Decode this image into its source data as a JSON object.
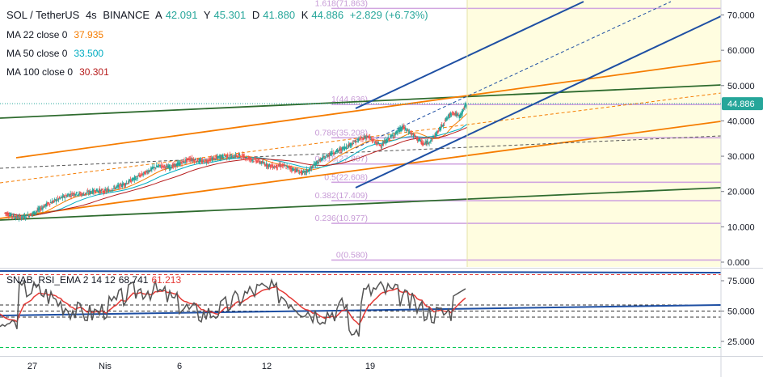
{
  "header": {
    "symbol": "SOL / TetherUS",
    "interval": "4s",
    "exchange": "BINANCE",
    "ohlc": {
      "open_label": "A",
      "open": "42.091",
      "high_label": "Y",
      "high": "45.301",
      "low_label": "D",
      "low": "41.880",
      "close_label": "K",
      "close": "44.886",
      "change": "+2.829 (+6.73%)"
    }
  },
  "indicators": [
    {
      "label": "MA 22 close 0",
      "value": "37.935",
      "color": "#f57c00"
    },
    {
      "label": "MA 50 close 0",
      "value": "33.500",
      "color": "#00acc1"
    },
    {
      "label": "MA 100 close 0",
      "value": "30.301",
      "color": "#b71c1c"
    }
  ],
  "rsi_legend": {
    "label": "SNAB_RSI_EMA 2 14 12",
    "value1": "68.741",
    "value1_color": "#131722",
    "value2": "61.213",
    "value2_color": "#e53935"
  },
  "price_badge": {
    "value": "44.886",
    "color": "#26a69a"
  },
  "colors": {
    "up": "#26a69a",
    "down": "#ef5350",
    "fib_line": "#d1a6e0",
    "fib_text": "#c79bd6",
    "orange": "#f57c00",
    "green": "#2e6b2e",
    "blue": "#1e4fa3",
    "rsi": "#555555",
    "rsi_ema": "#e53935",
    "projection": "#fffde0"
  },
  "chart_data": {
    "type": "candlestick",
    "price_axis": {
      "ylim": [
        0,
        73
      ],
      "ticks": [
        "70.000",
        "60.000",
        "50.000",
        "40.000",
        "30.000",
        "20.000",
        "10.000",
        "0.000"
      ]
    },
    "time_axis": {
      "ticks": [
        "27",
        "Nis",
        "6",
        "12",
        "19"
      ]
    },
    "fibonacci": [
      {
        "label": "1.618(71.863)",
        "level": 71.863
      },
      {
        "label": "1(44.636)",
        "level": 44.636
      },
      {
        "label": "0.786(35.208)",
        "level": 35.208
      },
      {
        "label": "0.618(27.807)",
        "level": 27.807
      },
      {
        "label": "0.5(22.608)",
        "level": 22.608
      },
      {
        "label": "0.382(17.409)",
        "level": 17.409
      },
      {
        "label": "0.236(10.977)",
        "level": 10.977
      },
      {
        "label": "0(0.580)",
        "level": 0.58
      }
    ],
    "price_path": [
      [
        0,
        14.0
      ],
      [
        1,
        13.2
      ],
      [
        2,
        12.6
      ],
      [
        3,
        12.9
      ],
      [
        4,
        13.8
      ],
      [
        5,
        15.0
      ],
      [
        6,
        16.4
      ],
      [
        7,
        17.3
      ],
      [
        8,
        18.2
      ],
      [
        9,
        19.0
      ],
      [
        10,
        19.5
      ],
      [
        11,
        19.2
      ],
      [
        12,
        19.8
      ],
      [
        13,
        20.3
      ],
      [
        14,
        20.0
      ],
      [
        15,
        20.6
      ],
      [
        16,
        21.4
      ],
      [
        17,
        22.2
      ],
      [
        18,
        23.3
      ],
      [
        19,
        24.4
      ],
      [
        20,
        25.5
      ],
      [
        21,
        26.7
      ],
      [
        22,
        27.3
      ],
      [
        23,
        26.8
      ],
      [
        24,
        27.4
      ],
      [
        25,
        28.2
      ],
      [
        26,
        29.2
      ],
      [
        27,
        28.8
      ],
      [
        28,
        28.4
      ],
      [
        29,
        29.1
      ],
      [
        30,
        29.6
      ],
      [
        31,
        30.1
      ],
      [
        32,
        29.8
      ],
      [
        33,
        30.3
      ],
      [
        34,
        29.6
      ],
      [
        35,
        29.0
      ],
      [
        36,
        28.3
      ],
      [
        37,
        27.5
      ],
      [
        38,
        27.0
      ],
      [
        39,
        27.4
      ],
      [
        40,
        26.8
      ],
      [
        41,
        26.0
      ],
      [
        42,
        25.2
      ],
      [
        43,
        26.3
      ],
      [
        44,
        28.3
      ],
      [
        45,
        29.6
      ],
      [
        46,
        30.9
      ],
      [
        47,
        31.6
      ],
      [
        48,
        32.6
      ],
      [
        49,
        33.8
      ],
      [
        50,
        34.8
      ],
      [
        51,
        35.6
      ],
      [
        52,
        34.2
      ],
      [
        53,
        33.0
      ],
      [
        54,
        34.9
      ],
      [
        55,
        36.4
      ],
      [
        56,
        38.2
      ],
      [
        57,
        36.8
      ],
      [
        58,
        35.1
      ],
      [
        59,
        33.3
      ],
      [
        60,
        34.6
      ],
      [
        61,
        37.0
      ],
      [
        62,
        40.1
      ],
      [
        63,
        42.5
      ],
      [
        64,
        41.2
      ],
      [
        65,
        44.9
      ]
    ],
    "rsi_axis": {
      "ylim": [
        15,
        85
      ],
      "ticks": [
        "75.000",
        "50.000",
        "25.000"
      ]
    },
    "rsi_levels": [
      80,
      55,
      50,
      45,
      20
    ]
  }
}
